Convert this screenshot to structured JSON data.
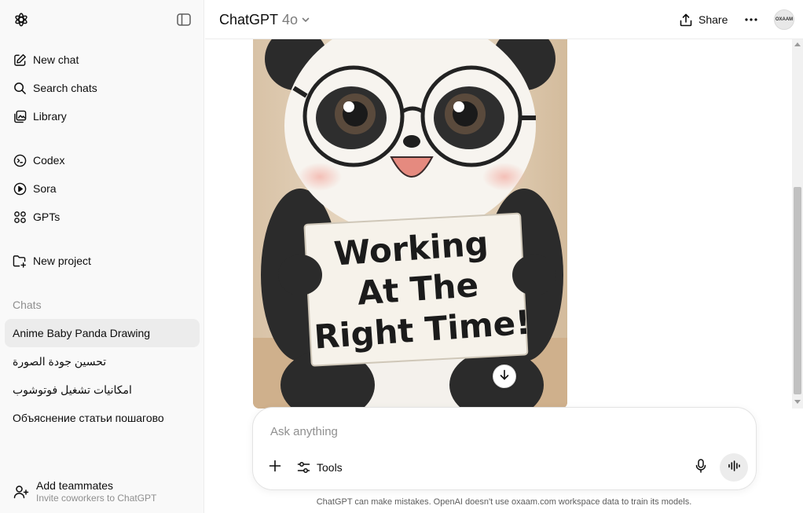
{
  "sidebar": {
    "nav": [
      {
        "label": "New chat",
        "icon": "pencil-square-icon"
      },
      {
        "label": "Search chats",
        "icon": "search-icon"
      },
      {
        "label": "Library",
        "icon": "library-icon"
      },
      {
        "label": "Codex",
        "icon": "codex-icon"
      },
      {
        "label": "Sora",
        "icon": "play-circle-icon"
      },
      {
        "label": "GPTs",
        "icon": "grid-icon"
      },
      {
        "label": "New project",
        "icon": "folder-plus-icon"
      }
    ],
    "chats_label": "Chats",
    "chats": [
      {
        "title": "Anime Baby Panda Drawing",
        "active": true
      },
      {
        "title": "تحسين جودة الصورة",
        "active": false
      },
      {
        "title": "امكانيات تشغيل فوتوشوب",
        "active": false
      },
      {
        "title": "Объяснение статьи пошагово",
        "active": false
      }
    ],
    "footer": {
      "title": "Add teammates",
      "subtitle": "Invite coworkers to ChatGPT"
    }
  },
  "header": {
    "model_name": "ChatGPT",
    "model_version": "4o",
    "share_label": "Share",
    "avatar_text": "OXAAM"
  },
  "image": {
    "sign_lines": [
      "Working",
      "At The",
      "Right Time!"
    ]
  },
  "composer": {
    "placeholder": "Ask anything",
    "tools_label": "Tools"
  },
  "disclaimer": "ChatGPT can make mistakes. OpenAI doesn't use oxaam.com workspace data to train its models.",
  "colors": {
    "sidebar_bg": "#f9f9f9",
    "active_chat_bg": "#ececec",
    "muted_text": "#8f8f8f"
  }
}
